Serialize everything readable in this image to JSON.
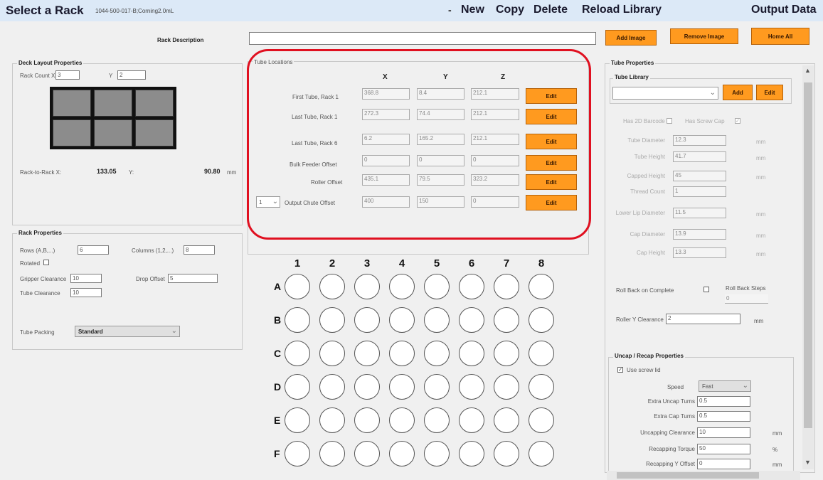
{
  "topbar": {
    "title": "Select a Rack",
    "rack_name": "1044-500-017-B;Corning2.0mL",
    "dropdown_glyph": "-",
    "menu": [
      "New",
      "Copy",
      "Delete",
      "Reload Library",
      "Output Data"
    ]
  },
  "rack_description": {
    "label": "Rack Description",
    "value": ""
  },
  "buttons": {
    "add_image": "Add Image",
    "remove_image": "Remove Image",
    "home_all": "Home All"
  },
  "deck_layout": {
    "title": "Deck Layout Properties",
    "rack_count_x_label": "Rack Count X",
    "rack_count_x": "3",
    "y_label": "Y",
    "rack_count_y": "2",
    "rack_to_rack_label": "Rack-to-Rack X:",
    "rack_to_rack_x": "133.05",
    "rack_to_rack_y_label": "Y:",
    "rack_to_rack_y": "90.80",
    "unit": "mm"
  },
  "rack_properties": {
    "title": "Rack Properties",
    "rows_label": "Rows (A,B,...)",
    "rows": "6",
    "columns_label": "Columns (1,2,...)",
    "columns": "8",
    "rotated_label": "Rotated",
    "gripper_clearance_label": "Gripper Clearance",
    "gripper_clearance": "10",
    "drop_offset_label": "Drop Offset",
    "drop_offset": "5",
    "tube_clearance_label": "Tube Clearance",
    "tube_clearance": "10",
    "tube_packing_label": "Tube Packing",
    "tube_packing": "Standard"
  },
  "tube_locations": {
    "title": "Tube Locations",
    "headers": [
      "X",
      "Y",
      "Z"
    ],
    "edit_label": "Edit",
    "output_chute_select": "1",
    "rows": [
      {
        "label": "First Tube, Rack 1",
        "x": "368.8",
        "y": "8.4",
        "z": "212.1"
      },
      {
        "label": "Last Tube, Rack 1",
        "x": "272.3",
        "y": "74.4",
        "z": "212.1"
      },
      {
        "label": "Last Tube, Rack 6",
        "x": "6.2",
        "y": "165.2",
        "z": "212.1"
      },
      {
        "label": "Bulk Feeder Offset",
        "x": "0",
        "y": "0",
        "z": "0"
      },
      {
        "label": "Roller Offset",
        "x": "435.1",
        "y": "79.5",
        "z": "323.2"
      },
      {
        "label": "Output Chute Offset",
        "x": "400",
        "y": "150",
        "z": "0"
      }
    ]
  },
  "plate": {
    "columns": [
      "1",
      "2",
      "3",
      "4",
      "5",
      "6",
      "7",
      "8"
    ],
    "rows": [
      "A",
      "B",
      "C",
      "D",
      "E",
      "F"
    ]
  },
  "tube_properties": {
    "title": "Tube Properties",
    "library_title": "Tube Library",
    "library_value": "",
    "add_label": "Add",
    "edit_label": "Edit",
    "has_2d_barcode_label": "Has 2D Barcode",
    "has_screw_cap_label": "Has Screw Cap",
    "has_screw_cap_checked": "✓",
    "fields": [
      {
        "label": "Tube Diameter",
        "value": "12.3",
        "unit": "mm"
      },
      {
        "label": "Tube Height",
        "value": "41.7",
        "unit": "mm"
      },
      {
        "label": "Capped Height",
        "value": "45",
        "unit": "mm"
      },
      {
        "label": "Thread Count",
        "value": "1",
        "unit": ""
      },
      {
        "label": "Lower Lip Diameter",
        "value": "11.5",
        "unit": "mm"
      },
      {
        "label": "Cap Diameter",
        "value": "13.9",
        "unit": "mm"
      },
      {
        "label": "Cap Height",
        "value": "13.3",
        "unit": "mm"
      }
    ],
    "roll_back_label": "Roll Back on Complete",
    "roll_back_steps_label": "Roll Back Steps",
    "roll_back_steps": "0",
    "roller_y_clearance_label": "Roller Y Clearance",
    "roller_y_clearance": "2",
    "roller_unit": "mm"
  },
  "uncap": {
    "title": "Uncap / Recap Properties",
    "use_screw_lid_label": "Use screw lid",
    "use_screw_lid_checked": "✓",
    "speed_label": "Speed",
    "speed": "Fast",
    "fields": [
      {
        "label": "Extra Uncap Turns",
        "value": "0.5",
        "unit": ""
      },
      {
        "label": "Extra Cap Turns",
        "value": "0.5",
        "unit": ""
      },
      {
        "label": "Uncapping Clearance",
        "value": "10",
        "unit": "mm"
      },
      {
        "label": "Recapping Torque",
        "value": "50",
        "unit": "%"
      },
      {
        "label": "Recapping Y Offset",
        "value": "0",
        "unit": "mm"
      }
    ]
  },
  "icons": {
    "dropdown": "chevron-down-icon",
    "scroll_up": "caret-up-icon",
    "scroll_down": "caret-down-icon"
  },
  "colors": {
    "accent_orange": "#ff9a1f",
    "highlight_red": "#e01020",
    "topbar_bg": "#dce9f7"
  }
}
